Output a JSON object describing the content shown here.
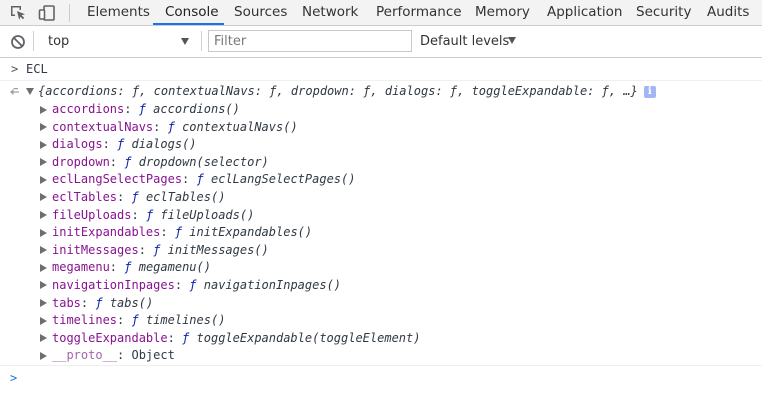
{
  "tabbar": {
    "tabs": [
      {
        "label": "Elements"
      },
      {
        "label": "Console"
      },
      {
        "label": "Sources"
      },
      {
        "label": "Network"
      },
      {
        "label": "Performance"
      },
      {
        "label": "Memory"
      },
      {
        "label": "Application"
      },
      {
        "label": "Security"
      },
      {
        "label": "Audits"
      }
    ],
    "active_tab": "Console",
    "accent_color": "#1a73e8"
  },
  "toolbar": {
    "context": "top",
    "filter_placeholder": "Filter",
    "levels_label": "Default levels"
  },
  "console": {
    "input_prompt": ">",
    "input_text": "ECL",
    "summary": {
      "open": "{",
      "entries": [
        {
          "key": "accordions",
          "value": "ƒ"
        },
        {
          "key": "contextualNavs",
          "value": "ƒ"
        },
        {
          "key": "dropdown",
          "value": "ƒ"
        },
        {
          "key": "dialogs",
          "value": "ƒ"
        },
        {
          "key": "toggleExpandable",
          "value": "ƒ"
        }
      ],
      "tail": "…}",
      "info_badge": "i"
    },
    "properties": [
      {
        "key": "accordions",
        "f": "ƒ",
        "sig": "accordions()"
      },
      {
        "key": "contextualNavs",
        "f": "ƒ",
        "sig": "contextualNavs()"
      },
      {
        "key": "dialogs",
        "f": "ƒ",
        "sig": "dialogs()"
      },
      {
        "key": "dropdown",
        "f": "ƒ",
        "sig": "dropdown(selector)"
      },
      {
        "key": "eclLangSelectPages",
        "f": "ƒ",
        "sig": "eclLangSelectPages()"
      },
      {
        "key": "eclTables",
        "f": "ƒ",
        "sig": "eclTables()"
      },
      {
        "key": "fileUploads",
        "f": "ƒ",
        "sig": "fileUploads()"
      },
      {
        "key": "initExpandables",
        "f": "ƒ",
        "sig": "initExpandables()"
      },
      {
        "key": "initMessages",
        "f": "ƒ",
        "sig": "initMessages()"
      },
      {
        "key": "megamenu",
        "f": "ƒ",
        "sig": "megamenu()"
      },
      {
        "key": "navigationInpages",
        "f": "ƒ",
        "sig": "navigationInpages()"
      },
      {
        "key": "tabs",
        "f": "ƒ",
        "sig": "tabs()"
      },
      {
        "key": "timelines",
        "f": "ƒ",
        "sig": "timelines()"
      },
      {
        "key": "toggleExpandable",
        "f": "ƒ",
        "sig": "toggleExpandable(toggleElement)"
      }
    ],
    "proto": {
      "key": "__proto__",
      "value": "Object"
    },
    "prompt_caret": ">"
  }
}
